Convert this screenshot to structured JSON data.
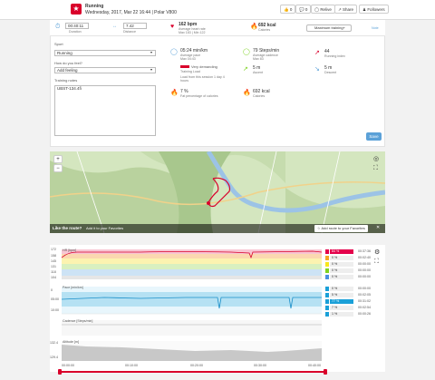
{
  "header": {
    "title": "Running",
    "subtitle": "Wednesday, 2017, Mar 22 16:44 | Polar V800",
    "like_count": "0",
    "comment_count": "0",
    "relive_label": "Relive",
    "share_label": "Share",
    "followers_label": "Followers"
  },
  "summary": {
    "duration_value": "00:40:11",
    "duration_label": "Duration",
    "distance_value": "7.42",
    "distance_label": "Distance",
    "hr_value": "162 bpm",
    "hr_label": "Average heart rate",
    "hr_sub": "Max 183 | Min 122",
    "calories_value": "692 kcal",
    "calories_label": "Calories",
    "training_button": "Maximum training+",
    "note_link": "Note"
  },
  "form": {
    "sport_label": "Sport",
    "sport_value": "Running",
    "feel_label": "How do you feel?",
    "feel_value": "Add feeling",
    "notes_label": "Training notes",
    "notes_value": "UBST-134.4fi",
    "save_button": "Save"
  },
  "metrics": {
    "pace_value": "05:24 min/km",
    "pace_label": "Average pace",
    "pace_sub": "Max 04:43",
    "cadence_value": "79 Steps/min",
    "cadence_label": "Average cadence",
    "cadence_sub": "Max 83",
    "running_index_value": "44",
    "running_index_label": "Running index",
    "load_label": "Very demanding",
    "load_title": "Training Load",
    "load_desc": "Load from this session 1 day 4 hours",
    "ascent_value": "5 m",
    "ascent_label": "Ascent",
    "descent_value": "5 m",
    "descent_label": "Descent",
    "fat_value": "7 %",
    "fat_label": "Fat percentage of calories",
    "kcal_value": "692 kcal",
    "kcal_label": "Calories"
  },
  "map": {
    "like_route": "Like the route?",
    "like_sub": "Add it to your Favorites",
    "add_fav": "Add route to your Favorites",
    "zoom_in": "+",
    "zoom_out": "−"
  },
  "chart": {
    "hr_label": "HR [bpm]",
    "pace_label": "Pace [min/km]",
    "cadence_label": "Cadence [Steps/min]",
    "altitude_label": "Altitude [m]",
    "hr_ticks": [
      "172",
      "158",
      "145",
      "131",
      "118",
      "104"
    ],
    "pace_ticks": [
      "0",
      "05:00",
      "10:00"
    ],
    "alt_ticks": [
      "132.4",
      "129.4"
    ],
    "x_ticks": [
      "00:00:00",
      "00:10:00",
      "00:20:00",
      "00:30:00",
      "00:40:00"
    ],
    "hr_zones": [
      {
        "label": "5",
        "value": "84 %",
        "time": "00:37:36",
        "color": "#e4004b"
      },
      {
        "label": "4",
        "value": "0 %",
        "time": "00:02:40",
        "color": "#f5a623"
      },
      {
        "label": "3",
        "value": "0 %",
        "time": "00:00:00",
        "color": "#f8e71c"
      },
      {
        "label": "2",
        "value": "0 %",
        "time": "00:00:00",
        "color": "#7ed321"
      },
      {
        "label": "1",
        "value": "0 %",
        "time": "00:00:00",
        "color": "#4a90e2"
      }
    ],
    "pace_zones": [
      {
        "label": "5",
        "value": "0 %",
        "time": "00:00:00",
        "color": "#1aa0d8"
      },
      {
        "label": "4",
        "value": "5 %",
        "time": "00:02:05",
        "color": "#1aa0d8"
      },
      {
        "label": "3",
        "value": "77 %",
        "time": "00:31:02",
        "color": "#1aa0d8"
      },
      {
        "label": "2",
        "value": "7 %",
        "time": "00:02:54",
        "color": "#1aa0d8"
      },
      {
        "label": "1",
        "value": "1 %",
        "time": "00:00:26",
        "color": "#1aa0d8"
      }
    ]
  }
}
